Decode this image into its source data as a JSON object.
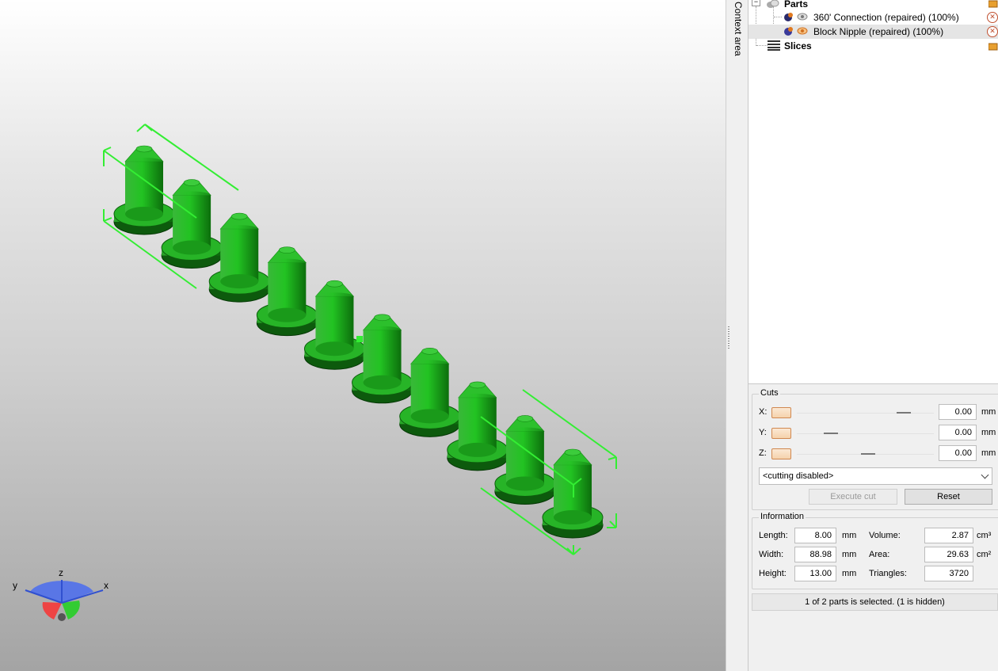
{
  "context_tab": {
    "label": "Context area"
  },
  "tree": {
    "parts_label": "Parts",
    "items": [
      {
        "label": "360' Connection (repaired) (100%)"
      },
      {
        "label": "Block Nipple (repaired) (100%)"
      }
    ],
    "slices_label": "Slices"
  },
  "cuts": {
    "title": "Cuts",
    "rows": [
      {
        "axis": "X:",
        "value": "0.00",
        "unit": "mm",
        "position": 0.78
      },
      {
        "axis": "Y:",
        "value": "0.00",
        "unit": "mm",
        "position": 0.25
      },
      {
        "axis": "Z:",
        "value": "0.00",
        "unit": "mm",
        "position": 0.52
      }
    ],
    "mode": "<cutting disabled>",
    "execute_label": "Execute cut",
    "reset_label": "Reset"
  },
  "info": {
    "title": "Information",
    "length_label": "Length:",
    "length_value": "8.00",
    "length_unit": "mm",
    "width_label": "Width:",
    "width_value": "88.98",
    "width_unit": "mm",
    "height_label": "Height:",
    "height_value": "13.00",
    "height_unit": "mm",
    "volume_label": "Volume:",
    "volume_value": "2.87",
    "volume_unit": "cm³",
    "area_label": "Area:",
    "area_value": "29.63",
    "area_unit": "cm²",
    "triangles_label": "Triangles:",
    "triangles_value": "3720"
  },
  "status": "1 of 2 parts is selected. (1 is hidden)",
  "axes": {
    "x": "x",
    "y": "y",
    "z": "z"
  },
  "model": {
    "nipple_count": 10,
    "color": "#22b022"
  }
}
